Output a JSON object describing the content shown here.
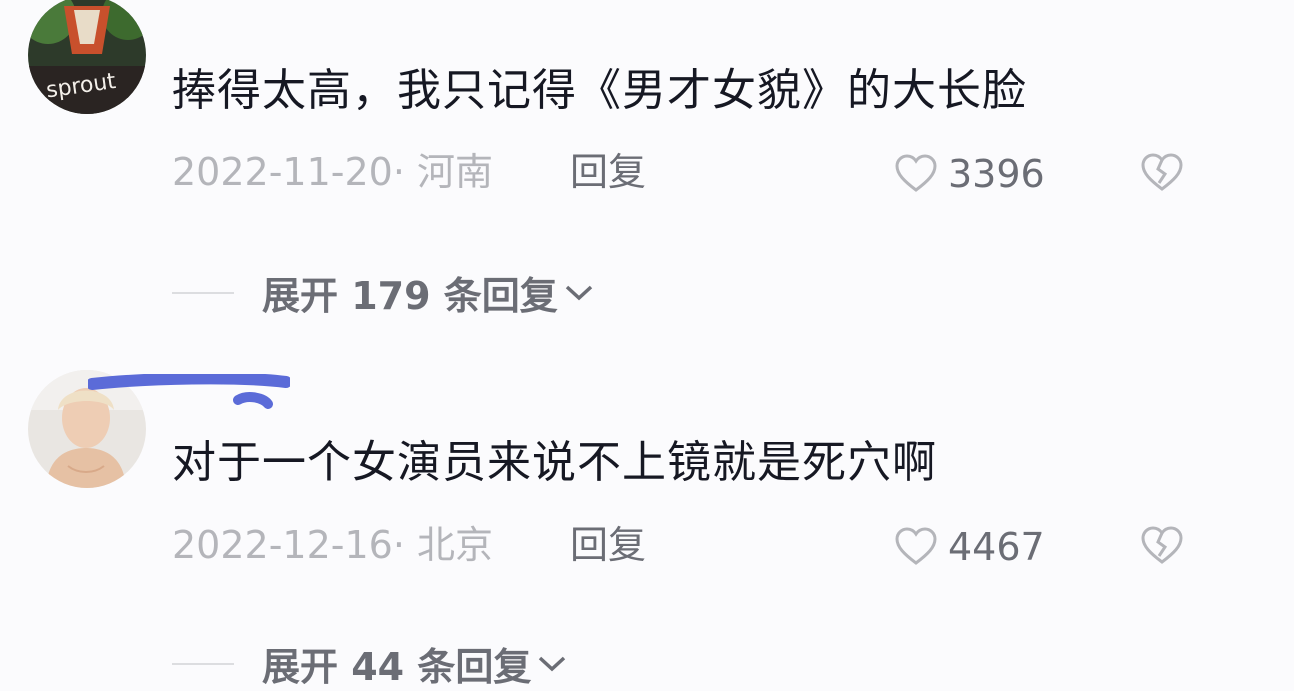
{
  "comments": [
    {
      "text": "捧得太高，我只记得《男才女貌》的大长脸",
      "date_location": "2022-11-20· 河南",
      "reply_label": "回复",
      "likes": "3396",
      "expand_label": "展开 179 条回复",
      "avatar_text": "sprout"
    },
    {
      "text": "对于一个女演员来说不上镜就是死穴啊",
      "date_location": "2022-12-16· 北京",
      "reply_label": "回复",
      "likes": "4467",
      "expand_label": "展开 44 条回复"
    }
  ],
  "colors": {
    "primary_text": "#161823",
    "secondary_text": "#b4b5ba",
    "action_text": "#6b6d75",
    "redaction_marker": "#5b6bd8"
  },
  "icons": [
    "heart-outline-icon",
    "broken-heart-icon",
    "chevron-down-icon"
  ]
}
